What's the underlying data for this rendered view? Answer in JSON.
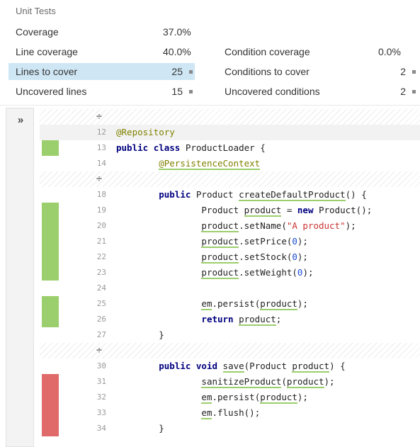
{
  "metrics": {
    "title": "Unit Tests",
    "coverage": {
      "label": "Coverage",
      "value": "37.0%"
    },
    "line_coverage": {
      "label": "Line coverage",
      "value": "40.0%"
    },
    "condition_coverage": {
      "label": "Condition coverage",
      "value": "0.0%"
    },
    "lines_to_cover": {
      "label": "Lines to cover",
      "value": "25"
    },
    "conditions_to_cover": {
      "label": "Conditions to cover",
      "value": "2"
    },
    "uncovered_lines": {
      "label": "Uncovered lines",
      "value": "15"
    },
    "uncovered_conditions": {
      "label": "Uncovered conditions",
      "value": "2"
    }
  },
  "sidebar": {
    "expand_icon": "»"
  },
  "gap_icon": "÷",
  "colors": {
    "covered": "#9bce6c",
    "uncovered": "#e06a6a",
    "highlight": "#cfe7f5"
  },
  "lines": [
    {
      "type": "gap"
    },
    {
      "num": "12",
      "cov": "",
      "hl": true,
      "tokens": [
        {
          "t": "@Repository",
          "c": "ann"
        }
      ]
    },
    {
      "num": "13",
      "cov": "green",
      "tokens": [
        {
          "t": "public",
          "c": "kw"
        },
        {
          "t": " "
        },
        {
          "t": "class",
          "c": "kw"
        },
        {
          "t": " ProductLoader {"
        }
      ]
    },
    {
      "num": "14",
      "cov": "",
      "tokens": [
        {
          "t": "        "
        },
        {
          "t": "@PersistenceContext",
          "c": "ann",
          "u": true
        }
      ]
    },
    {
      "type": "gap"
    },
    {
      "num": "18",
      "cov": "",
      "tokens": [
        {
          "t": "        "
        },
        {
          "t": "public",
          "c": "kw"
        },
        {
          "t": " Product "
        },
        {
          "t": "createDefaultProduct",
          "u": true
        },
        {
          "t": "() {"
        }
      ]
    },
    {
      "num": "19",
      "cov": "green",
      "tokens": [
        {
          "t": "                Product "
        },
        {
          "t": "product",
          "u": true
        },
        {
          "t": " = "
        },
        {
          "t": "new",
          "c": "kw"
        },
        {
          "t": " Product();"
        }
      ]
    },
    {
      "num": "20",
      "cov": "green",
      "tokens": [
        {
          "t": "                "
        },
        {
          "t": "product",
          "u": true
        },
        {
          "t": ".setName("
        },
        {
          "t": "\"A product\"",
          "c": "str"
        },
        {
          "t": ");"
        }
      ]
    },
    {
      "num": "21",
      "cov": "green",
      "tokens": [
        {
          "t": "                "
        },
        {
          "t": "product",
          "u": true
        },
        {
          "t": ".setPrice("
        },
        {
          "t": "0",
          "c": "num"
        },
        {
          "t": ");"
        }
      ]
    },
    {
      "num": "22",
      "cov": "green",
      "tokens": [
        {
          "t": "                "
        },
        {
          "t": "product",
          "u": true
        },
        {
          "t": ".setStock("
        },
        {
          "t": "0",
          "c": "num"
        },
        {
          "t": ");"
        }
      ]
    },
    {
      "num": "23",
      "cov": "green",
      "tokens": [
        {
          "t": "                "
        },
        {
          "t": "product",
          "u": true
        },
        {
          "t": ".setWeight("
        },
        {
          "t": "0",
          "c": "num"
        },
        {
          "t": ");"
        }
      ]
    },
    {
      "num": "24",
      "cov": "",
      "tokens": []
    },
    {
      "num": "25",
      "cov": "green",
      "tokens": [
        {
          "t": "                "
        },
        {
          "t": "em",
          "u": true
        },
        {
          "t": ".persist("
        },
        {
          "t": "product",
          "u": true
        },
        {
          "t": ");"
        }
      ]
    },
    {
      "num": "26",
      "cov": "green",
      "tokens": [
        {
          "t": "                "
        },
        {
          "t": "return",
          "c": "kw"
        },
        {
          "t": " "
        },
        {
          "t": "product",
          "u": true
        },
        {
          "t": ";"
        }
      ]
    },
    {
      "num": "27",
      "cov": "",
      "tokens": [
        {
          "t": "        }"
        }
      ]
    },
    {
      "type": "gap"
    },
    {
      "num": "30",
      "cov": "",
      "tokens": [
        {
          "t": "        "
        },
        {
          "t": "public",
          "c": "kw"
        },
        {
          "t": " "
        },
        {
          "t": "void",
          "c": "kw"
        },
        {
          "t": " "
        },
        {
          "t": "save",
          "u": true
        },
        {
          "t": "(Product "
        },
        {
          "t": "product",
          "u": true
        },
        {
          "t": ") {"
        }
      ]
    },
    {
      "num": "31",
      "cov": "red",
      "tokens": [
        {
          "t": "                "
        },
        {
          "t": "sanitizeProduct",
          "u": true
        },
        {
          "t": "("
        },
        {
          "t": "product",
          "u": true
        },
        {
          "t": ");"
        }
      ]
    },
    {
      "num": "32",
      "cov": "red",
      "tokens": [
        {
          "t": "                "
        },
        {
          "t": "em",
          "u": true
        },
        {
          "t": ".persist("
        },
        {
          "t": "product",
          "u": true
        },
        {
          "t": ");"
        }
      ]
    },
    {
      "num": "33",
      "cov": "red",
      "tokens": [
        {
          "t": "                "
        },
        {
          "t": "em",
          "u": true
        },
        {
          "t": ".flush();"
        }
      ]
    },
    {
      "num": "34",
      "cov": "red",
      "tokens": [
        {
          "t": "        }"
        }
      ]
    }
  ]
}
